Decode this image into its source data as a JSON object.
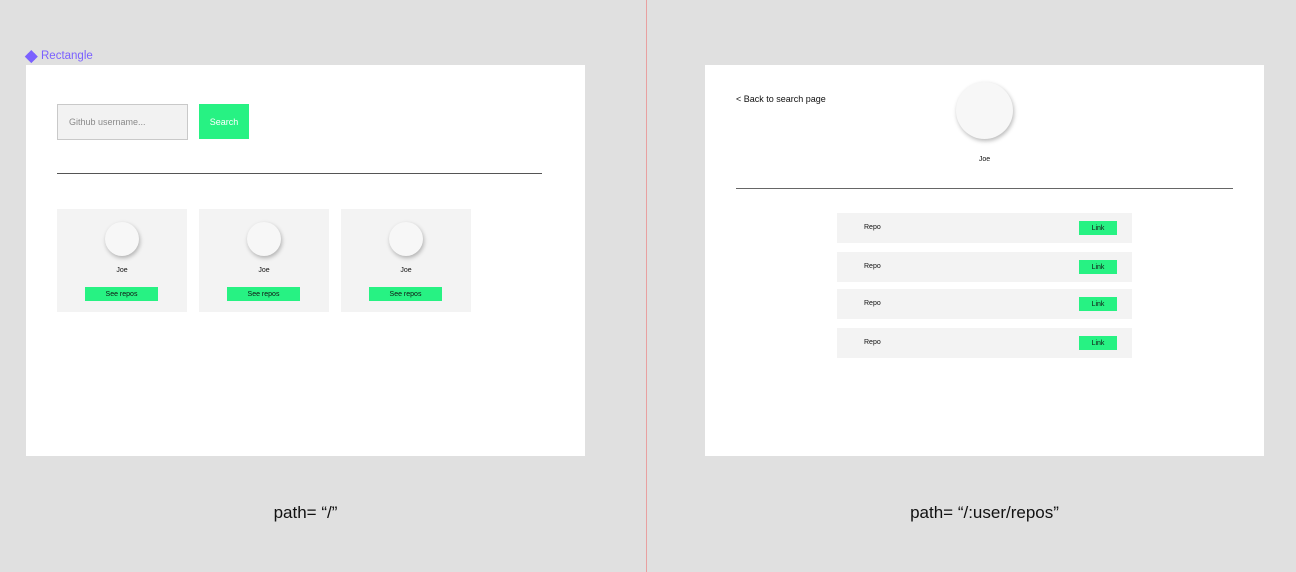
{
  "home_frame": {
    "frame_label": "Rectangle",
    "search": {
      "placeholder": "Github username...",
      "button_label": "Search"
    },
    "results": [
      {
        "name": "Joe",
        "button_label": "See repos"
      },
      {
        "name": "Joe",
        "button_label": "See repos"
      },
      {
        "name": "Joe",
        "button_label": "See repos"
      }
    ],
    "path_caption": "path= “/”"
  },
  "repos_frame": {
    "back_link": "< Back to search page",
    "user_name": "Joe",
    "repos": [
      {
        "name": "Repo",
        "link_label": "Link"
      },
      {
        "name": "Repo",
        "link_label": "Link"
      },
      {
        "name": "Repo",
        "link_label": "Link"
      },
      {
        "name": "Repo",
        "link_label": "Link"
      }
    ],
    "path_caption": "path= “/:user/repos”"
  },
  "colors": {
    "canvas": "#e0e0e0",
    "accent_green": "#27f283",
    "component_label": "#7b61ff",
    "divider": "#e8a0a0"
  }
}
